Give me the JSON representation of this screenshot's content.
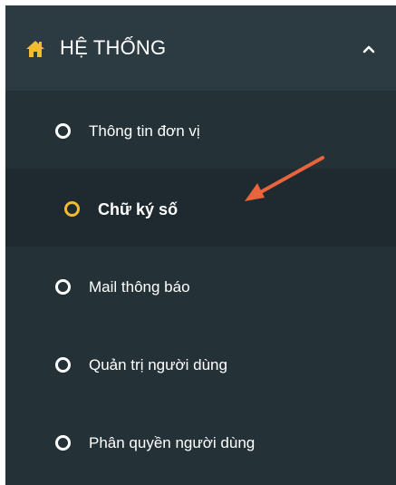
{
  "menu": {
    "header": {
      "title": "HỆ THỐNG",
      "icon": "home-icon",
      "toggle_icon": "chevron-up-icon",
      "expanded": true
    },
    "items": [
      {
        "label": "Thông tin đơn vị",
        "active": false
      },
      {
        "label": "Chữ ký số",
        "active": true
      },
      {
        "label": "Mail thông báo",
        "active": false
      },
      {
        "label": "Quản trị người dùng",
        "active": false
      },
      {
        "label": "Phân quyền người dùng",
        "active": false
      }
    ]
  },
  "colors": {
    "sidebar_bg": "#243238",
    "header_bg": "#2c3b42",
    "active_bg": "#1e2a30",
    "active_ring": "#f2bc30",
    "home_icon": "#f2bc30",
    "annotation_arrow": "#e8643c"
  }
}
